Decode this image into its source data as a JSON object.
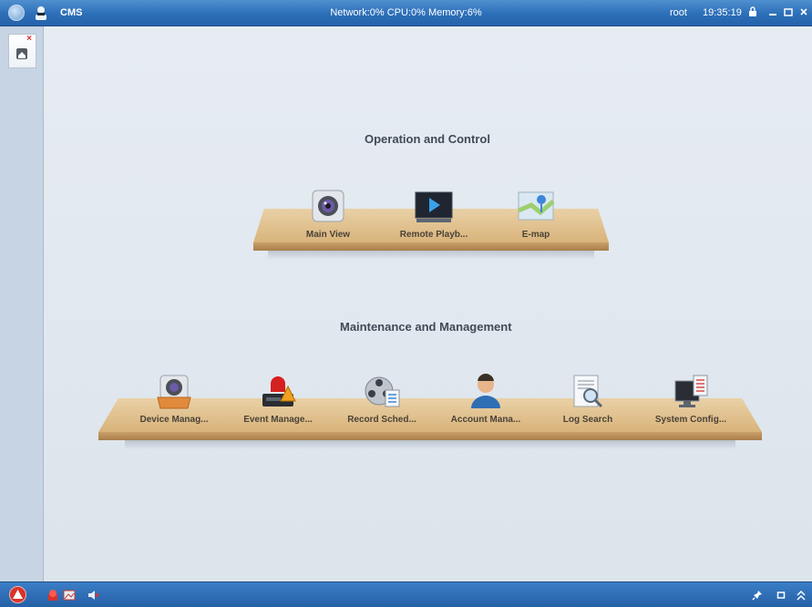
{
  "topbar": {
    "title": "CMS",
    "status": "Network:0% CPU:0% Memory:6%",
    "user": "root",
    "time": "19:35:19"
  },
  "sidebar": {
    "tabs": [
      {
        "icon": "home-icon",
        "close": "×"
      }
    ]
  },
  "sections": {
    "operation": {
      "title": "Operation and Control",
      "items": [
        {
          "label": "Main View",
          "icon": "camera-icon"
        },
        {
          "label": "Remote Playb...",
          "icon": "playback-icon"
        },
        {
          "label": "E-map",
          "icon": "map-icon"
        }
      ]
    },
    "maintenance": {
      "title": "Maintenance and Management",
      "items": [
        {
          "label": "Device Manag...",
          "icon": "device-camera-icon"
        },
        {
          "label": "Event Manage...",
          "icon": "alarm-icon"
        },
        {
          "label": "Record Sched...",
          "icon": "film-reel-icon"
        },
        {
          "label": "Account Mana...",
          "icon": "user-icon"
        },
        {
          "label": "Log Search",
          "icon": "log-search-icon"
        },
        {
          "label": "System Config...",
          "icon": "monitor-config-icon"
        }
      ]
    }
  },
  "colors": {
    "topbar": "#2c6fb8",
    "bottombar": "#2560a6",
    "shelf": "#ddbb86",
    "background": "#dfe6ee"
  }
}
